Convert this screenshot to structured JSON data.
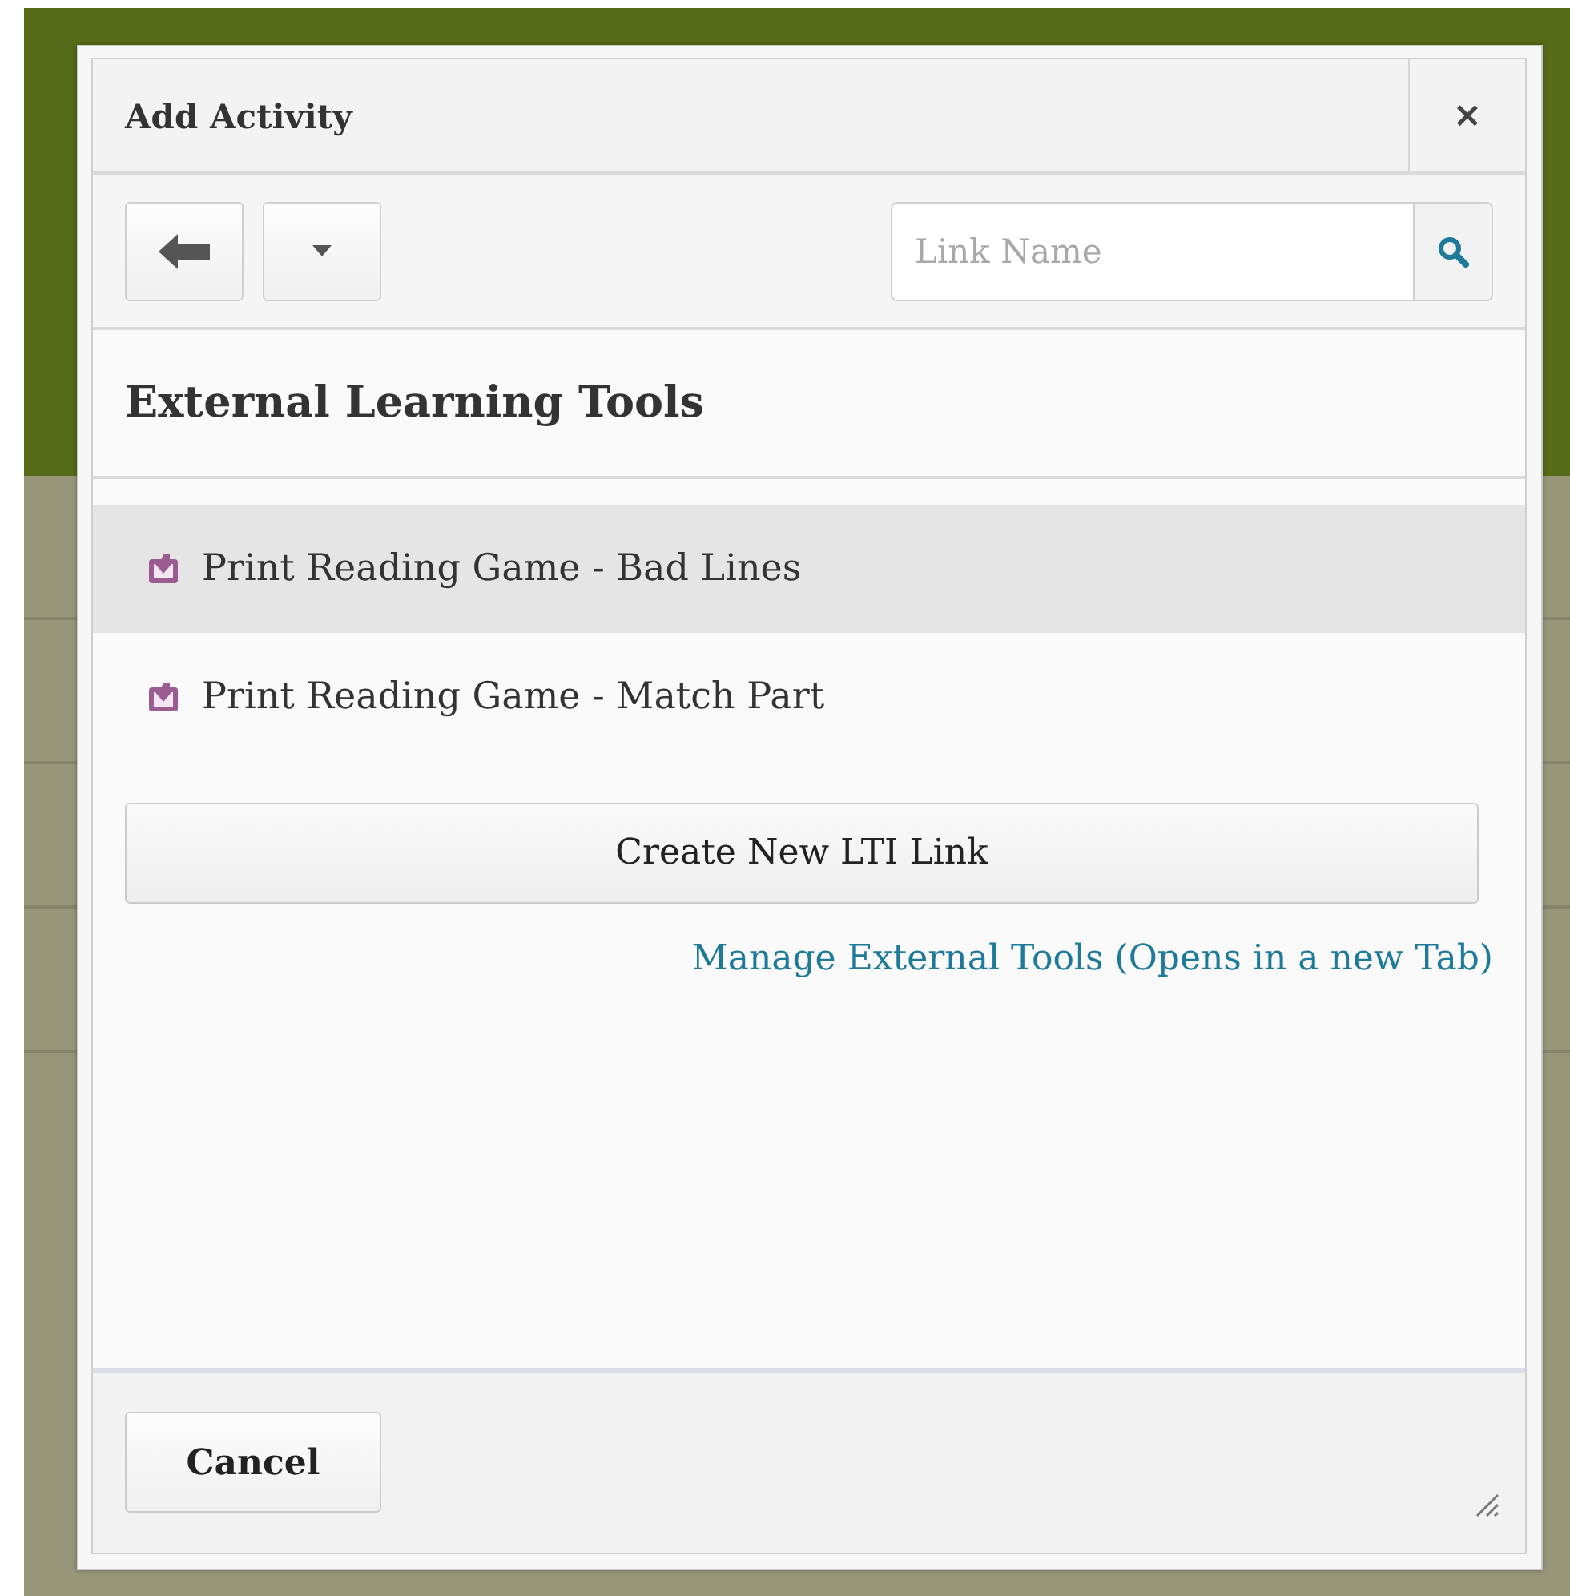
{
  "dialog": {
    "title": "Add Activity",
    "close": "×"
  },
  "search": {
    "placeholder": "Link Name"
  },
  "section": {
    "heading": "External Learning Tools"
  },
  "items": [
    {
      "label": "Print Reading Game - Bad Lines",
      "selected": true
    },
    {
      "label": "Print Reading Game - Match Part",
      "selected": false
    }
  ],
  "create_button": "Create New LTI Link",
  "manage_link": "Manage External Tools (Opens in a new Tab)",
  "footer": {
    "cancel": "Cancel"
  }
}
